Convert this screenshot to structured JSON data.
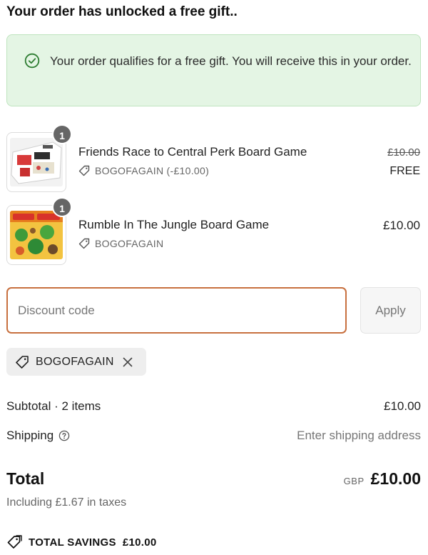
{
  "heading": "Your order has unlocked a free gift..",
  "notice": {
    "message": "Your order qualifies for a free gift. You will receive this in your order.",
    "icon": "check-circle-icon"
  },
  "items": [
    {
      "name": "Friends Race to Central Perk Board Game",
      "quantity": "1",
      "discount": "BOGOFAGAIN (-£10.00)",
      "original_price": "£10.00",
      "price": "FREE",
      "image_label": "FRIENDS"
    },
    {
      "name": "Rumble In The Jungle Board Game",
      "quantity": "1",
      "discount": "BOGOFAGAIN",
      "price": "£10.00",
      "image_label": "RUMBLE JUNGLE"
    }
  ],
  "discount": {
    "placeholder": "Discount code",
    "apply_label": "Apply",
    "applied_code": "BOGOFAGAIN"
  },
  "summary": {
    "subtotal_label": "Subtotal · 2 items",
    "subtotal_value": "£10.00",
    "shipping_label": "Shipping",
    "shipping_value": "Enter shipping address",
    "total_label": "Total",
    "currency": "GBP",
    "total_value": "£10.00",
    "tax_note": "Including £1.67 in taxes",
    "savings_label": "TOTAL SAVINGS",
    "savings_value": "£10.00"
  },
  "colors": {
    "notice_bg": "#e4f5e4",
    "notice_icon": "#2e7d32",
    "input_focus_border": "#c8703f",
    "badge_bg": "#666666"
  }
}
